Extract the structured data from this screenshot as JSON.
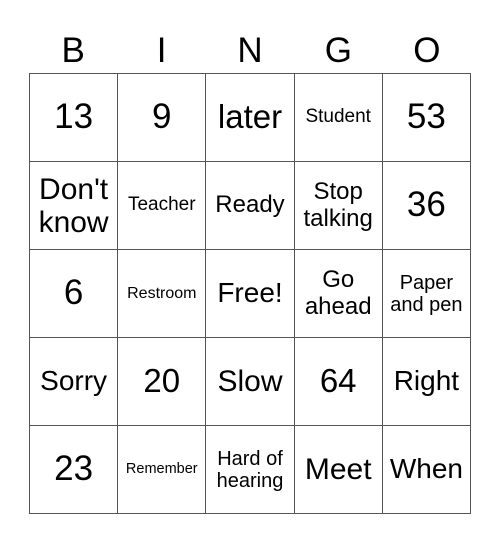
{
  "header": [
    "B",
    "I",
    "N",
    "G",
    "O"
  ],
  "cells": [
    [
      "13",
      "9",
      "later",
      "Student",
      "53"
    ],
    [
      "Don't know",
      "Teacher",
      "Ready",
      "Stop talking",
      "36"
    ],
    [
      "6",
      "Restroom",
      "Free!",
      "Go ahead",
      "Paper and pen"
    ],
    [
      "Sorry",
      "20",
      "Slow",
      "64",
      "Right"
    ],
    [
      "23",
      "Remember",
      "Hard of hearing",
      "Meet",
      "When"
    ]
  ]
}
